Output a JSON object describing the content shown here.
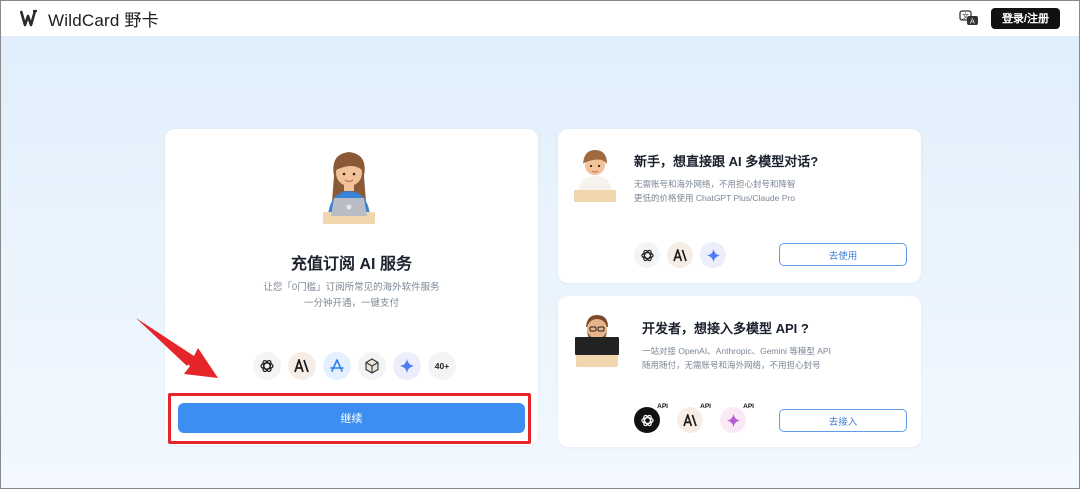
{
  "header": {
    "brand": "WildCard 野卡",
    "login_label": "登录/注册",
    "icons": {
      "logo": "wildcard-logo-icon",
      "language": "translate-icon"
    }
  },
  "main_card": {
    "title": "充值订阅 AI 服务",
    "desc_line1": "让您「0门槛」订阅所常见的海外软件服务",
    "desc_line2": "一分钟开通，一键支付",
    "services": [
      "openai-icon",
      "anthropic-icon",
      "app-store-icon",
      "box-icon",
      "gemini-icon"
    ],
    "services_more": "40+",
    "continue_label": "继续"
  },
  "card_chat": {
    "title": "新手，想直接跟 AI 多模型对话?",
    "desc_line1": "无需账号和海外网络，不用担心封号和降智",
    "desc_line2": "更低的价格使用 ChatGPT Plus/Claude Pro",
    "icons": [
      "openai-icon",
      "anthropic-icon",
      "gemini-icon"
    ],
    "button_label": "去使用"
  },
  "card_api": {
    "title": "开发者，想接入多模型 API ?",
    "desc_line1": "一站对接 OpenAI、Anthropic、Gemini 等模型 API",
    "desc_line2": "随用随付，无需账号和海外网络，不用担心封号",
    "api_tag": "API",
    "icons": [
      "openai-icon",
      "anthropic-icon",
      "gemini-icon"
    ],
    "button_label": "去接入"
  },
  "colors": {
    "accent": "#3d8ef1",
    "highlight": "#e5252a",
    "button_dark": "#111111"
  }
}
